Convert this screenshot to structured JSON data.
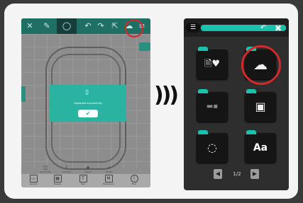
{
  "left_screen": {
    "toolbar_icons": [
      "close-icon",
      "pencil-icon",
      "circle-icon",
      "undo-icon",
      "redo-icon",
      "export-icon",
      "cloud-icon",
      "menu-icon"
    ],
    "dialog": {
      "message": "Uploaded successfully",
      "confirm_glyph": "✔"
    },
    "mini_tools": [
      "Add Photo",
      "Line art",
      "Layers",
      "Zoom"
    ],
    "bottom_tabs": [
      "Layout",
      "Design",
      "Text",
      "Monogram",
      "Misc"
    ]
  },
  "signal_glyph": ")))",
  "right_screen": {
    "menu_glyph": "☰",
    "undo_glyph": "↶",
    "close_glyph": "✖",
    "tiles": [
      {
        "name": "favorite-file-tile",
        "glyph": "🖹♥"
      },
      {
        "name": "cloud-upload-tile",
        "glyph": "☁"
      },
      {
        "name": "video-tile",
        "glyph": "▬▪"
      },
      {
        "name": "image-tile",
        "glyph": "▣"
      },
      {
        "name": "dotted-circle-tile",
        "glyph": "◌"
      },
      {
        "name": "text-tile",
        "glyph": "Aa"
      }
    ],
    "pager": {
      "prev": "◀",
      "label": "1/2",
      "next": "▶"
    }
  },
  "colors": {
    "teal": "#18c2ab",
    "dark_teal": "#1f6f64",
    "highlight_circle": "#d22a2a"
  }
}
